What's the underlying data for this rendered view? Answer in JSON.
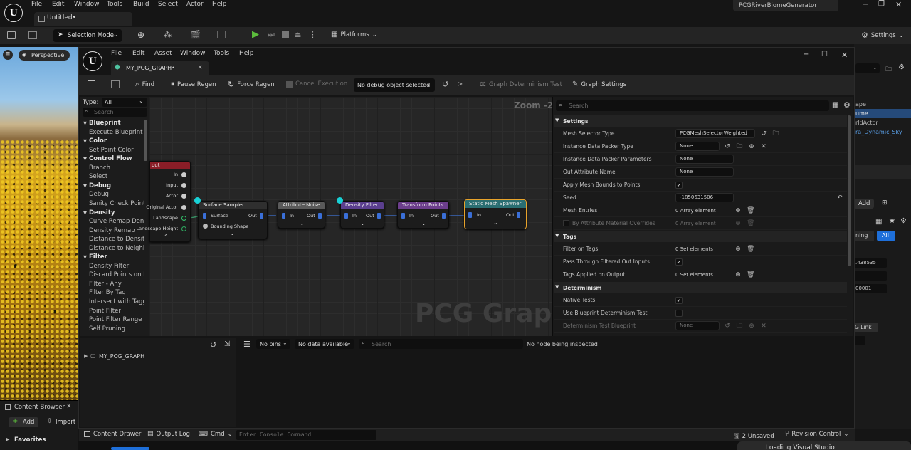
{
  "main_menu": {
    "items": [
      "File",
      "Edit",
      "Window",
      "Tools",
      "Build",
      "Select",
      "Actor",
      "Help"
    ],
    "project_name": "PCGRiverBiomeGenerator"
  },
  "level_tab": {
    "title": "Untitled•"
  },
  "main_toolbar": {
    "selection_mode": "Selection Mode",
    "platforms": "Platforms",
    "settings": "Settings"
  },
  "viewport": {
    "perspective_label": "Perspective"
  },
  "content_browser": {
    "title": "Content Browser",
    "add_label": "Add",
    "import_label": "Import",
    "favorites_label": "Favorites"
  },
  "pcg_window": {
    "menu": [
      "File",
      "Edit",
      "Asset",
      "Window",
      "Tools",
      "Help"
    ],
    "tab_title": "MY_PCG_GRAPH•",
    "toolbar": {
      "find": "Find",
      "pause_regen": "Pause Regen",
      "force_regen": "Force Regen",
      "cancel_execution": "Cancel Execution",
      "debug_object": "No debug object selected",
      "determinism_test": "Graph Determinism Test",
      "graph_settings": "Graph Settings"
    }
  },
  "palette": {
    "type_label": "Type:",
    "type_value": "All",
    "search_placeholder": "Search",
    "entries": [
      {
        "kind": "cat",
        "text": "Blueprint"
      },
      {
        "kind": "item",
        "text": "Execute Blueprint"
      },
      {
        "kind": "cat",
        "text": "Color"
      },
      {
        "kind": "item",
        "text": "Set Point Color"
      },
      {
        "kind": "cat",
        "text": "Control Flow"
      },
      {
        "kind": "item",
        "text": "Branch"
      },
      {
        "kind": "item",
        "text": "Select"
      },
      {
        "kind": "cat",
        "text": "Debug"
      },
      {
        "kind": "item",
        "text": "Debug"
      },
      {
        "kind": "item",
        "text": "Sanity Check Point"
      },
      {
        "kind": "cat",
        "text": "Density"
      },
      {
        "kind": "item",
        "text": "Curve Remap Dens"
      },
      {
        "kind": "item",
        "text": "Density Remap"
      },
      {
        "kind": "item",
        "text": "Distance to Density"
      },
      {
        "kind": "item",
        "text": "Distance to Neighb"
      },
      {
        "kind": "cat",
        "text": "Filter"
      },
      {
        "kind": "item",
        "text": "Density Filter"
      },
      {
        "kind": "item",
        "text": "Discard Points on I"
      },
      {
        "kind": "item",
        "text": "Filter - Any"
      },
      {
        "kind": "item",
        "text": "Filter By Tag"
      },
      {
        "kind": "item",
        "text": "Intersect with Tagg"
      },
      {
        "kind": "item",
        "text": "Point Filter"
      },
      {
        "kind": "item",
        "text": "Point Filter Range"
      },
      {
        "kind": "item",
        "text": "Self Pruning"
      }
    ]
  },
  "graph": {
    "zoom_label": "Zoom -2",
    "watermark": "PCG Graph",
    "input_node": {
      "title": "out",
      "pins": [
        "In",
        "Input",
        "Actor",
        "Original Actor",
        "Landscape",
        "Landscape Height"
      ]
    },
    "nodes": [
      {
        "title": "Surface Sampler",
        "color": "#2f2f2f",
        "pins_in": [
          "Surface",
          "Bounding Shape"
        ],
        "pin_out": "Out"
      },
      {
        "title": "Attribute Noise",
        "color": "#5a5a5a",
        "pins_in": [
          "In"
        ],
        "pin_out": "Out"
      },
      {
        "title": "Density Filter",
        "color": "#5b3f8f",
        "pins_in": [
          "In"
        ],
        "pin_out": "Out"
      },
      {
        "title": "Transform Points",
        "color": "#6c3e8c",
        "pins_in": [
          "In"
        ],
        "pin_out": "Out"
      },
      {
        "title": "Static Mesh Spawner",
        "color": "#2a6e72",
        "pins_in": [
          "In"
        ],
        "pin_out": "Out"
      }
    ]
  },
  "details": {
    "search_placeholder": "Search",
    "sections": {
      "settings": "Settings",
      "tags": "Tags",
      "determinism": "Determinism"
    },
    "rows": {
      "mesh_selector_type": {
        "label": "Mesh Selector Type",
        "value": "PCGMeshSelectorWeighted"
      },
      "instance_data_packer_type": {
        "label": "Instance Data Packer Type",
        "value": "None"
      },
      "instance_data_packer_params": {
        "label": "Instance Data Packer Parameters",
        "value": "None"
      },
      "out_attribute_name": {
        "label": "Out Attribute Name",
        "value": "None"
      },
      "apply_mesh_bounds": {
        "label": "Apply Mesh Bounds to Points",
        "checked": true
      },
      "seed": {
        "label": "Seed",
        "value": "-1850631506"
      },
      "mesh_entries": {
        "label": "Mesh Entries",
        "value": "0 Array element"
      },
      "by_attribute_overrides": {
        "label": "By Attribute Material Overrides",
        "value": "0 Array element"
      },
      "filter_on_tags": {
        "label": "Filter on Tags",
        "value": "0 Set elements"
      },
      "pass_through": {
        "label": "Pass Through Filtered Out Inputs",
        "checked": true
      },
      "tags_applied": {
        "label": "Tags Applied on Output",
        "value": "0 Set elements"
      },
      "native_tests": {
        "label": "Native Tests",
        "checked": true
      },
      "use_bp_tests": {
        "label": "Use Blueprint Determinism Test",
        "checked": false
      },
      "determinism_bp": {
        "label": "Determinism Test Blueprint",
        "value": "None"
      }
    }
  },
  "debug_tree": {
    "root": "MY_PCG_GRAPH"
  },
  "inspector": {
    "pins_filter": "No pins",
    "data_filter": "No data available",
    "search_placeholder": "Search",
    "status": "No node being inspected"
  },
  "right_panel": {
    "outliner": [
      "ape",
      "ume",
      "rldActor",
      "ra_Dynamic_Sky"
    ],
    "add_label": "Add",
    "tab_left": "ning",
    "tab_all": "All",
    "values": [
      ".438535",
      "00001"
    ],
    "link_label": "G Link"
  },
  "status_bar": {
    "content_drawer": "Content Drawer",
    "output_log": "Output Log",
    "cmd": "Cmd",
    "console_placeholder": "Enter Console Command",
    "unsaved": "2 Unsaved",
    "revision_control": "Revision Control",
    "loading_toast": "Loading Visual Studio"
  }
}
